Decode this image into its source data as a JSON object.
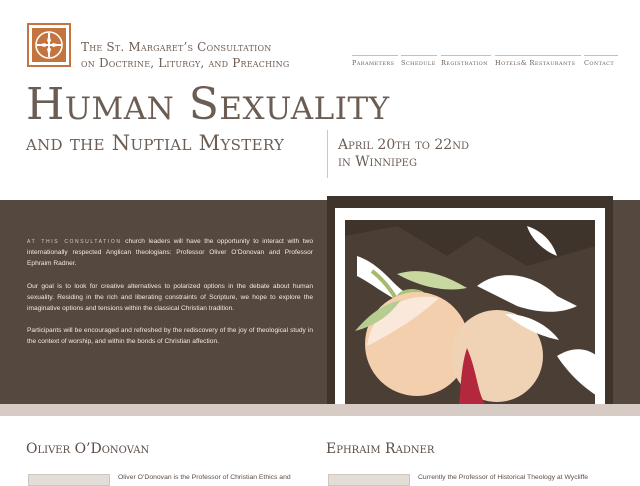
{
  "org": {
    "line1": "The St. Margaret’s Consultation",
    "line2": "on Doctrine, Liturgy, and Preaching"
  },
  "nav": [
    "Parameters",
    "Schedule",
    "Registration",
    "Hotels& Restaurants",
    "Contact"
  ],
  "event": {
    "title": "Human Sexuality",
    "subtitle": "and the Nuptial Mystery",
    "dates_line1": "April 20th to 22nd",
    "dates_line2": "in Winnipeg"
  },
  "intro": {
    "lead": "at this consultation",
    "p1": " church leaders will have the opportunity to interact with two internationally respected Anglican theologians: Professor Oliver O’Donovan and Professor Ephraim Radner.",
    "p2": "Our goal is to look for creative alternatives to polarized options in the debate about human sexuality. Residing in the rich and liberating constraints of Scripture, we hope to explore the imaginative options and tensions within the classical Christian tradition.",
    "p3": "Participants will be encouraged and refreshed by the rediscovery of the joy of theological study in the context of worship, and within the bonds of Christian affection."
  },
  "speakers": [
    {
      "name": "Oliver O’Donovan",
      "bio": "Oliver O’Donovan is the Professor of Christian Ethics and"
    },
    {
      "name": "Ephraim Radner",
      "bio": "Currently the Professor of Historical Theology at Wycliffe"
    }
  ],
  "colors": {
    "accent": "#c4753f",
    "band": "#55483f",
    "text": "#5a4d45"
  },
  "icons": [
    "cross-logo-icon"
  ]
}
